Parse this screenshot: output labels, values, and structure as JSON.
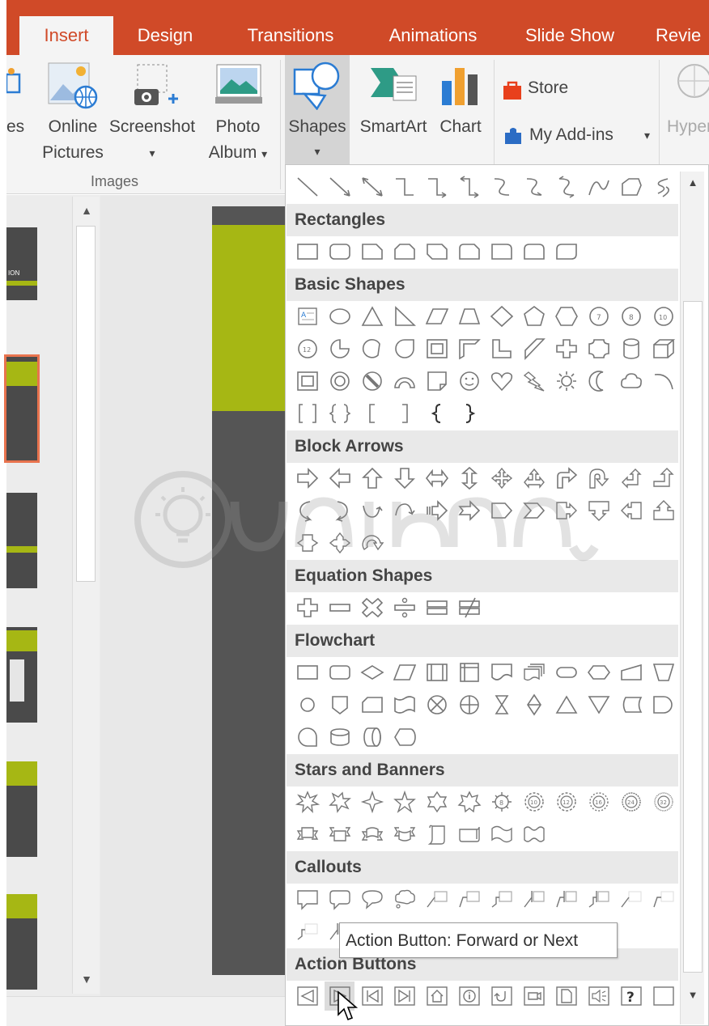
{
  "tabs": [
    "Insert",
    "Design",
    "Transitions",
    "Animations",
    "Slide Show",
    "Revie"
  ],
  "active_tab": "Insert",
  "ribbon": {
    "pictures_partial": "es",
    "online_pictures": [
      "Online",
      "Pictures"
    ],
    "screenshot": "Screenshot",
    "photo_album": [
      "Photo",
      "Album"
    ],
    "shapes": "Shapes",
    "smartart": "SmartArt",
    "chart": "Chart",
    "store": "Store",
    "my_addins": "My Add-ins",
    "hyper_partial": "Hyper",
    "group_images": "Images",
    "dropdown_glyph": "▾"
  },
  "thumbnail_label": "ION",
  "gallery": {
    "sections": {
      "rectangles": "Rectangles",
      "basic_shapes": "Basic Shapes",
      "block_arrows": "Block Arrows",
      "equation_shapes": "Equation Shapes",
      "flowchart": "Flowchart",
      "stars_banners": "Stars and Banners",
      "callouts": "Callouts",
      "action_buttons": "Action Buttons"
    },
    "tooltip": "Action Button: Forward or Next"
  },
  "colors": {
    "tab_bar": "#d04a28",
    "ribbon": "#f4f4f4",
    "accent_green": "#a6b714",
    "slide_dark": "#555555"
  }
}
